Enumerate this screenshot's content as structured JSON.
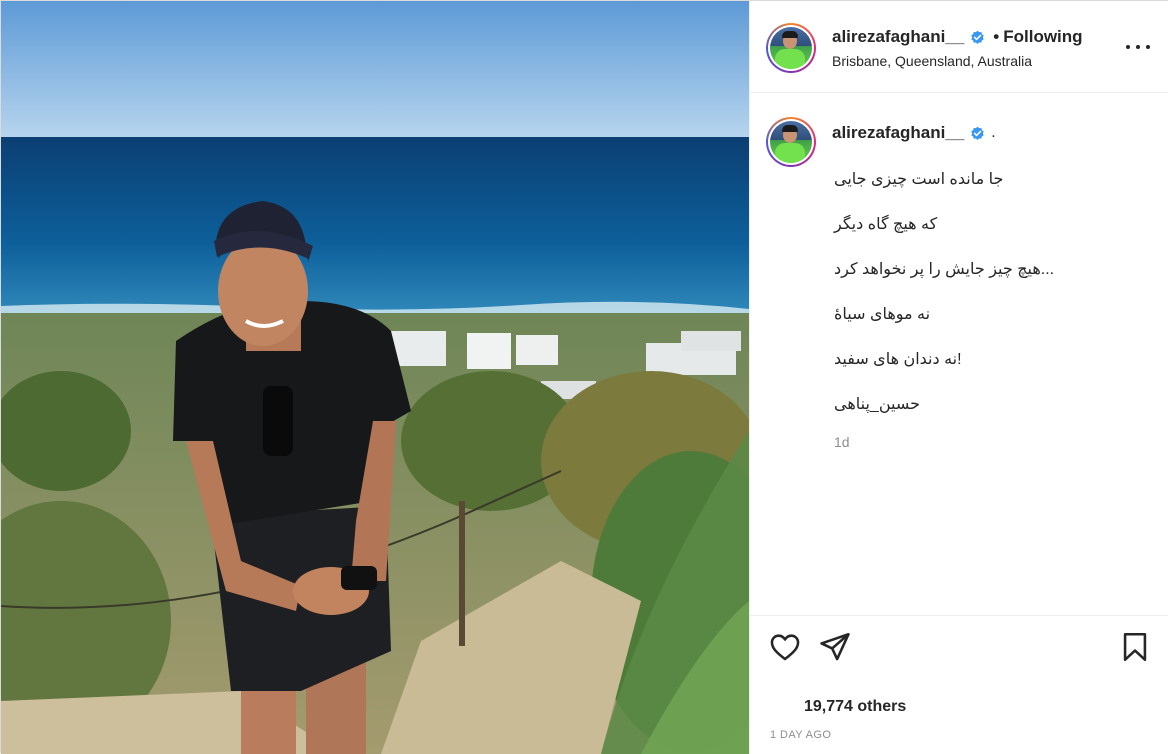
{
  "post": {
    "author": {
      "username": "alirezafaghani__",
      "follow_status": "Following",
      "separator": "•",
      "location": "Brisbane, Queensland, Australia"
    },
    "caption": {
      "username": "alirezafaghani__",
      "suffix": ".",
      "lines": [
        "جا مانده است چیزی جایی",
        "که هیچ گاه دیگر",
        "...هیچ چیز جایش را پر نخواهد کرد",
        "نه موهای سیاهٔ",
        "!نه دندان های سفید",
        "حسین_پناهی"
      ],
      "time": "1d"
    },
    "likes_text": "19,774 others",
    "timestamp": "1 DAY AGO"
  },
  "icons": {
    "verified": "verified-badge-icon",
    "more": "more-options-icon",
    "like": "heart-icon",
    "share": "paper-plane-icon",
    "save": "bookmark-icon"
  },
  "colors": {
    "verified_blue": "#3897f0",
    "text": "#262626",
    "muted": "#8e8e8e",
    "border": "#efefef"
  }
}
